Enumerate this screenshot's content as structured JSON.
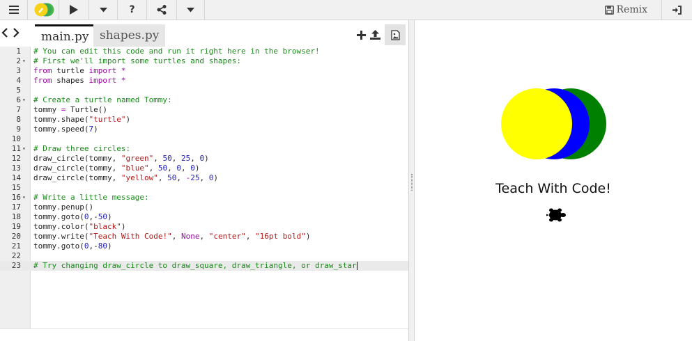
{
  "toolbar": {
    "menu_icon": "menu-icon",
    "logo_icon": "trinket-logo-icon",
    "run_icon": "play-icon",
    "run_options_icon": "caret-down-icon",
    "help_icon": "help-icon",
    "share_icon": "share-icon",
    "more_icon": "caret-down-icon",
    "remix_label": "Remix",
    "login_icon": "sign-in-icon"
  },
  "tabs": [
    {
      "label": "main.py",
      "active": true
    },
    {
      "label": "shapes.py",
      "active": false
    }
  ],
  "editor": {
    "active_line": 23,
    "lines": [
      {
        "n": "1",
        "fold": "",
        "text": "# You can edit this code and run it right here in the browser!"
      },
      {
        "n": "2",
        "fold": "▾",
        "text": "# First we'll import some turtles and shapes:"
      },
      {
        "n": "3",
        "fold": "",
        "text": "from turtle import *"
      },
      {
        "n": "4",
        "fold": "",
        "text": "from shapes import *"
      },
      {
        "n": "5",
        "fold": "",
        "text": ""
      },
      {
        "n": "6",
        "fold": "▾",
        "text": "# Create a turtle named Tommy:"
      },
      {
        "n": "7",
        "fold": "",
        "text": "tommy = Turtle()"
      },
      {
        "n": "8",
        "fold": "",
        "text": "tommy.shape(\"turtle\")"
      },
      {
        "n": "9",
        "fold": "",
        "text": "tommy.speed(7)"
      },
      {
        "n": "10",
        "fold": "",
        "text": ""
      },
      {
        "n": "11",
        "fold": "▾",
        "text": "# Draw three circles:"
      },
      {
        "n": "12",
        "fold": "",
        "text": "draw_circle(tommy, \"green\", 50, 25, 0)"
      },
      {
        "n": "13",
        "fold": "",
        "text": "draw_circle(tommy, \"blue\", 50, 0, 0)"
      },
      {
        "n": "14",
        "fold": "",
        "text": "draw_circle(tommy, \"yellow\", 50, -25, 0)"
      },
      {
        "n": "15",
        "fold": "",
        "text": ""
      },
      {
        "n": "16",
        "fold": "▾",
        "text": "# Write a little message:"
      },
      {
        "n": "17",
        "fold": "",
        "text": "tommy.penup()"
      },
      {
        "n": "18",
        "fold": "",
        "text": "tommy.goto(0,-50)"
      },
      {
        "n": "19",
        "fold": "",
        "text": "tommy.color(\"black\")"
      },
      {
        "n": "20",
        "fold": "",
        "text": "tommy.write(\"Teach With Code!\", None, \"center\", \"16pt bold\")"
      },
      {
        "n": "21",
        "fold": "",
        "text": "tommy.goto(0,-80)"
      },
      {
        "n": "22",
        "fold": "",
        "text": ""
      },
      {
        "n": "23",
        "fold": "",
        "text": "# Try changing draw_circle to draw_square, draw_triangle, or draw_star"
      }
    ]
  },
  "output": {
    "message": "Teach With Code!",
    "circle_colors": [
      "#008000",
      "#0000ff",
      "#ffff00"
    ]
  },
  "colors": {
    "comment": "#1a8a1a",
    "keyword": "#9a0aa4",
    "string": "#b01818",
    "number": "#2121b5"
  }
}
